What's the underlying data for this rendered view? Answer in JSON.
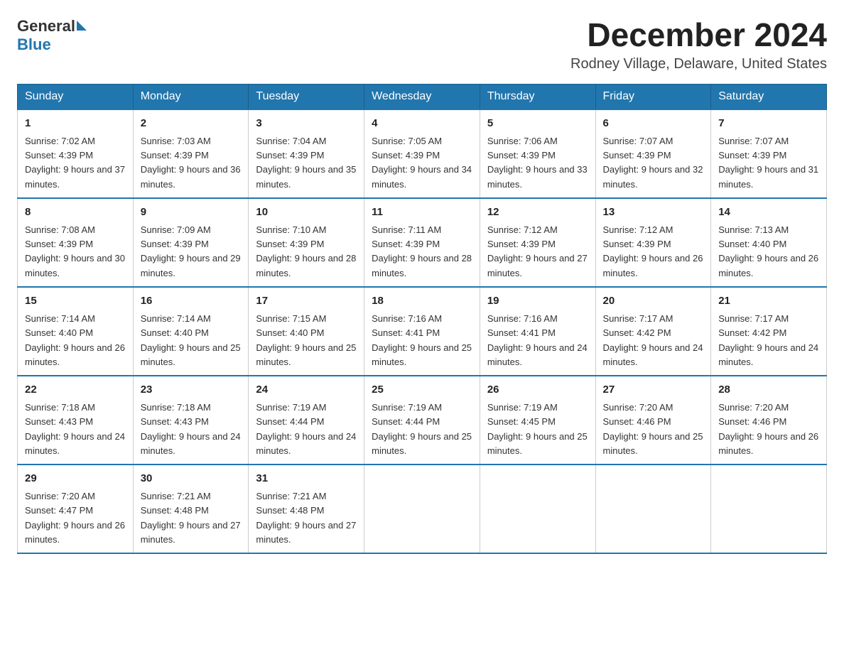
{
  "header": {
    "logo_general": "General",
    "logo_blue": "Blue",
    "month_title": "December 2024",
    "location": "Rodney Village, Delaware, United States"
  },
  "days_of_week": [
    "Sunday",
    "Monday",
    "Tuesday",
    "Wednesday",
    "Thursday",
    "Friday",
    "Saturday"
  ],
  "weeks": [
    [
      {
        "day": "1",
        "sunrise": "7:02 AM",
        "sunset": "4:39 PM",
        "daylight": "9 hours and 37 minutes."
      },
      {
        "day": "2",
        "sunrise": "7:03 AM",
        "sunset": "4:39 PM",
        "daylight": "9 hours and 36 minutes."
      },
      {
        "day": "3",
        "sunrise": "7:04 AM",
        "sunset": "4:39 PM",
        "daylight": "9 hours and 35 minutes."
      },
      {
        "day": "4",
        "sunrise": "7:05 AM",
        "sunset": "4:39 PM",
        "daylight": "9 hours and 34 minutes."
      },
      {
        "day": "5",
        "sunrise": "7:06 AM",
        "sunset": "4:39 PM",
        "daylight": "9 hours and 33 minutes."
      },
      {
        "day": "6",
        "sunrise": "7:07 AM",
        "sunset": "4:39 PM",
        "daylight": "9 hours and 32 minutes."
      },
      {
        "day": "7",
        "sunrise": "7:07 AM",
        "sunset": "4:39 PM",
        "daylight": "9 hours and 31 minutes."
      }
    ],
    [
      {
        "day": "8",
        "sunrise": "7:08 AM",
        "sunset": "4:39 PM",
        "daylight": "9 hours and 30 minutes."
      },
      {
        "day": "9",
        "sunrise": "7:09 AM",
        "sunset": "4:39 PM",
        "daylight": "9 hours and 29 minutes."
      },
      {
        "day": "10",
        "sunrise": "7:10 AM",
        "sunset": "4:39 PM",
        "daylight": "9 hours and 28 minutes."
      },
      {
        "day": "11",
        "sunrise": "7:11 AM",
        "sunset": "4:39 PM",
        "daylight": "9 hours and 28 minutes."
      },
      {
        "day": "12",
        "sunrise": "7:12 AM",
        "sunset": "4:39 PM",
        "daylight": "9 hours and 27 minutes."
      },
      {
        "day": "13",
        "sunrise": "7:12 AM",
        "sunset": "4:39 PM",
        "daylight": "9 hours and 26 minutes."
      },
      {
        "day": "14",
        "sunrise": "7:13 AM",
        "sunset": "4:40 PM",
        "daylight": "9 hours and 26 minutes."
      }
    ],
    [
      {
        "day": "15",
        "sunrise": "7:14 AM",
        "sunset": "4:40 PM",
        "daylight": "9 hours and 26 minutes."
      },
      {
        "day": "16",
        "sunrise": "7:14 AM",
        "sunset": "4:40 PM",
        "daylight": "9 hours and 25 minutes."
      },
      {
        "day": "17",
        "sunrise": "7:15 AM",
        "sunset": "4:40 PM",
        "daylight": "9 hours and 25 minutes."
      },
      {
        "day": "18",
        "sunrise": "7:16 AM",
        "sunset": "4:41 PM",
        "daylight": "9 hours and 25 minutes."
      },
      {
        "day": "19",
        "sunrise": "7:16 AM",
        "sunset": "4:41 PM",
        "daylight": "9 hours and 24 minutes."
      },
      {
        "day": "20",
        "sunrise": "7:17 AM",
        "sunset": "4:42 PM",
        "daylight": "9 hours and 24 minutes."
      },
      {
        "day": "21",
        "sunrise": "7:17 AM",
        "sunset": "4:42 PM",
        "daylight": "9 hours and 24 minutes."
      }
    ],
    [
      {
        "day": "22",
        "sunrise": "7:18 AM",
        "sunset": "4:43 PM",
        "daylight": "9 hours and 24 minutes."
      },
      {
        "day": "23",
        "sunrise": "7:18 AM",
        "sunset": "4:43 PM",
        "daylight": "9 hours and 24 minutes."
      },
      {
        "day": "24",
        "sunrise": "7:19 AM",
        "sunset": "4:44 PM",
        "daylight": "9 hours and 24 minutes."
      },
      {
        "day": "25",
        "sunrise": "7:19 AM",
        "sunset": "4:44 PM",
        "daylight": "9 hours and 25 minutes."
      },
      {
        "day": "26",
        "sunrise": "7:19 AM",
        "sunset": "4:45 PM",
        "daylight": "9 hours and 25 minutes."
      },
      {
        "day": "27",
        "sunrise": "7:20 AM",
        "sunset": "4:46 PM",
        "daylight": "9 hours and 25 minutes."
      },
      {
        "day": "28",
        "sunrise": "7:20 AM",
        "sunset": "4:46 PM",
        "daylight": "9 hours and 26 minutes."
      }
    ],
    [
      {
        "day": "29",
        "sunrise": "7:20 AM",
        "sunset": "4:47 PM",
        "daylight": "9 hours and 26 minutes."
      },
      {
        "day": "30",
        "sunrise": "7:21 AM",
        "sunset": "4:48 PM",
        "daylight": "9 hours and 27 minutes."
      },
      {
        "day": "31",
        "sunrise": "7:21 AM",
        "sunset": "4:48 PM",
        "daylight": "9 hours and 27 minutes."
      },
      null,
      null,
      null,
      null
    ]
  ]
}
